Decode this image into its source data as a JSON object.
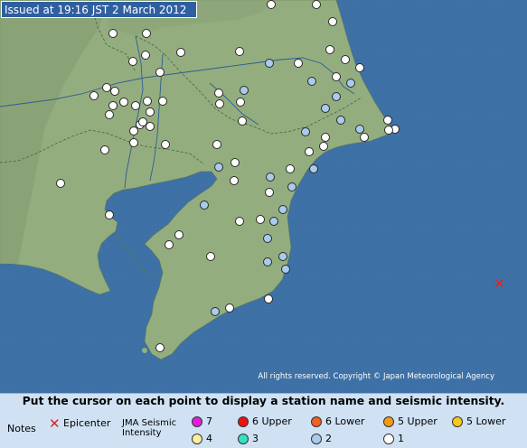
{
  "issued": "Issued at 19:16 JST  2 March 2012",
  "copyright": "All rights reserved. Copyright © Japan Meteorological Agency",
  "instruction": "Put the cursor on each point to display a station name and seismic intensity.",
  "legend": {
    "notes": "Notes",
    "epicenter": "Epicenter",
    "intensity_title": "JMA Seismic Intensity",
    "levels": [
      {
        "label": "7",
        "color": "#e020d8"
      },
      {
        "label": "6 Upper",
        "color": "#ee1111"
      },
      {
        "label": "6 Lower",
        "color": "#f06020"
      },
      {
        "label": "5 Upper",
        "color": "#f39a12"
      },
      {
        "label": "5 Lower",
        "color": "#f5c81a"
      },
      {
        "label": "4",
        "color": "#f6f19a"
      },
      {
        "label": "3",
        "color": "#35e0c4"
      },
      {
        "label": "2",
        "color": "#a9ccec"
      },
      {
        "label": "1",
        "color": "#ffffff"
      }
    ]
  },
  "colors": {
    "sea": "#3b6ea3",
    "land": "#93ad7c",
    "epicenter": "#e02222"
  }
}
